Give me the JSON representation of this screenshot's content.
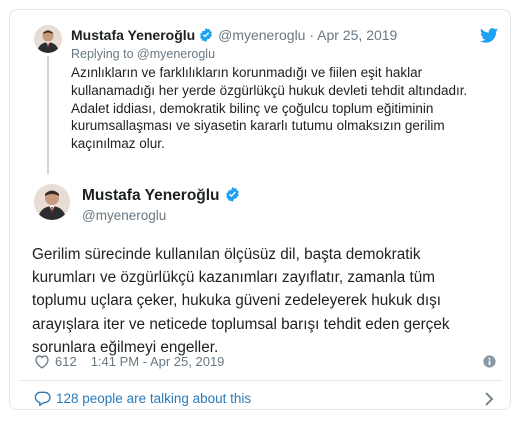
{
  "parent": {
    "name": "Mustafa Yeneroğlu",
    "handle": "@myeneroglu",
    "separator": "·",
    "date": "Apr 25, 2019",
    "reply_prefix": "Replying to",
    "reply_to": "@myeneroglu",
    "lines": [
      "Azınlıkların ve farklılıkların  korunmadığı ve fiilen eşit haklar",
      "kullanamadığı her yerde özgürlükçü hukuk devleti tehdit altındadır.",
      "Adalet iddiası, demokratik bilinç ve çoğulcu toplum eğitiminin",
      "kurumsallaşması ve siyasetin kararlı tutumu olmaksızın gerilim",
      "kaçınılmaz olur."
    ]
  },
  "tweet": {
    "name": "Mustafa Yeneroğlu",
    "handle": "@myeneroglu",
    "lines": [
      "Gerilim sürecinde kullanılan ölçüsüz  dil, başta demokratik",
      "kurumları ve özgürlükçü kazanımları zayıflatır, zamanla tüm",
      "toplumu uçlara çeker, hukuka güveni zedeleyerek hukuk dışı",
      "arayışlara iter ve neticede  toplumsal barışı tehdit eden gerçek",
      "sorunlara eğilmeyi engeller."
    ],
    "likes": "612",
    "time": "1:41 PM - Apr 25, 2019"
  },
  "footer": {
    "talking": "128 people are talking about this"
  },
  "colors": {
    "twitter_blue": "#1da1f2",
    "link_blue": "#2b7bb9",
    "muted": "#697882"
  },
  "icons": [
    "twitter-bird-icon",
    "verified-badge-icon",
    "heart-icon",
    "info-icon",
    "comment-bubble-icon",
    "chevron-right-icon"
  ]
}
